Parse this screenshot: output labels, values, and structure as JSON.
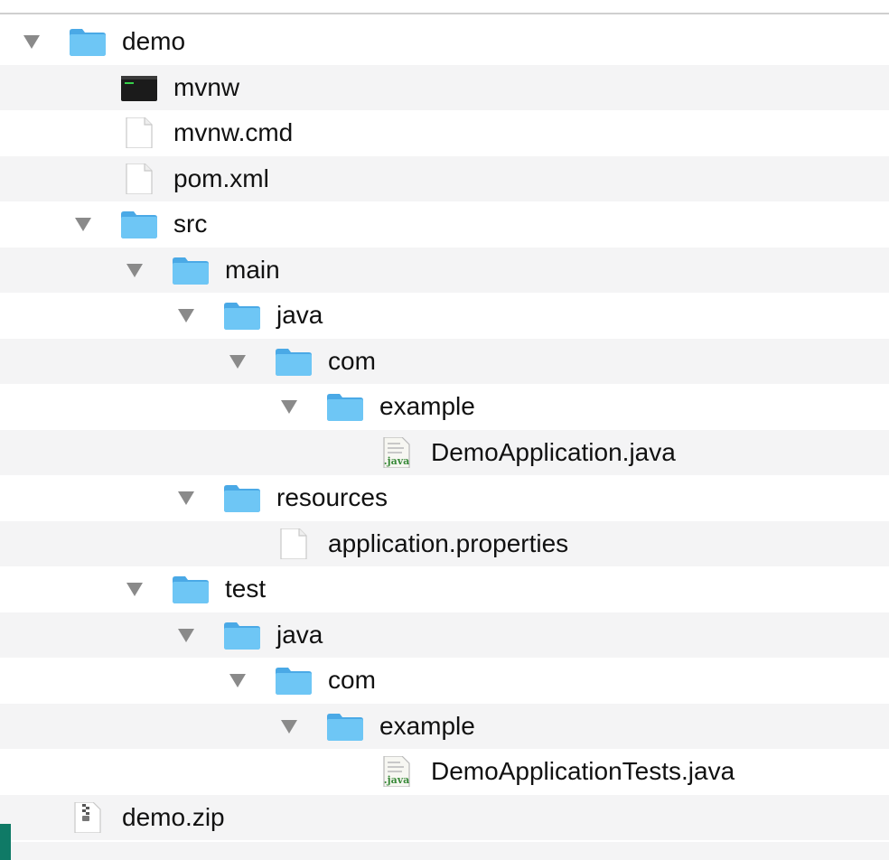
{
  "tree": {
    "items": [
      {
        "name": "demo",
        "kind": "folder",
        "depth": 0,
        "expanded": true
      },
      {
        "name": "mvnw",
        "kind": "exec",
        "depth": 1,
        "expanded": false
      },
      {
        "name": "mvnw.cmd",
        "kind": "file",
        "depth": 1,
        "expanded": false
      },
      {
        "name": "pom.xml",
        "kind": "file",
        "depth": 1,
        "expanded": false
      },
      {
        "name": "src",
        "kind": "folder",
        "depth": 1,
        "expanded": true
      },
      {
        "name": "main",
        "kind": "folder",
        "depth": 2,
        "expanded": true
      },
      {
        "name": "java",
        "kind": "folder",
        "depth": 3,
        "expanded": true
      },
      {
        "name": "com",
        "kind": "folder",
        "depth": 4,
        "expanded": true
      },
      {
        "name": "example",
        "kind": "folder",
        "depth": 5,
        "expanded": true
      },
      {
        "name": "DemoApplication.java",
        "kind": "java",
        "depth": 6,
        "expanded": false
      },
      {
        "name": "resources",
        "kind": "folder",
        "depth": 3,
        "expanded": true
      },
      {
        "name": "application.properties",
        "kind": "file",
        "depth": 4,
        "expanded": false
      },
      {
        "name": "test",
        "kind": "folder",
        "depth": 2,
        "expanded": true
      },
      {
        "name": "java",
        "kind": "folder",
        "depth": 3,
        "expanded": true
      },
      {
        "name": "com",
        "kind": "folder",
        "depth": 4,
        "expanded": true
      },
      {
        "name": "example",
        "kind": "folder",
        "depth": 5,
        "expanded": true
      },
      {
        "name": "DemoApplicationTests.java",
        "kind": "java",
        "depth": 6,
        "expanded": false
      },
      {
        "name": "demo.zip",
        "kind": "zip",
        "depth": 0,
        "expanded": false
      }
    ]
  },
  "colors": {
    "folder_front": "#6ec6f5",
    "folder_back": "#4aa9e6",
    "row_alt": "#f4f4f5",
    "disclosure": "#8a8a8a",
    "java_green": "#3a8a3a"
  },
  "icons": {
    "folder": "folder-icon",
    "exec": "terminal-exec-icon",
    "file": "document-icon",
    "java": "java-file-icon",
    "zip": "zip-archive-icon"
  }
}
